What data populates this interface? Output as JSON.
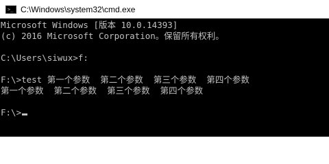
{
  "window": {
    "title": "C:\\Windows\\system32\\cmd.exe",
    "icon": "cmd-icon"
  },
  "console": {
    "lines": [
      "Microsoft Windows [版本 10.0.14393]",
      "(c) 2016 Microsoft Corporation。保留所有权利。",
      "",
      "C:\\Users\\siwux>f:",
      "",
      "F:\\>test 第一个参数  第二个参数  第三个参数  第四个参数",
      "第一个参数  第二个参数  第三个参数  第四个参数",
      "",
      "F:\\>"
    ],
    "text_color": "#c0c0c0",
    "background_color": "#000000"
  }
}
